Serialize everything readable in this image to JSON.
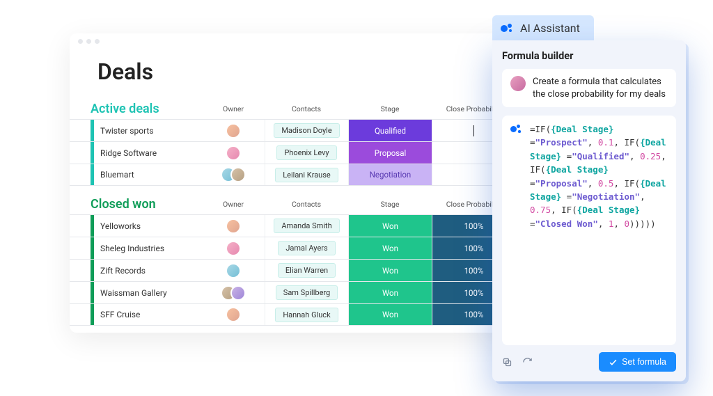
{
  "page": {
    "title": "Deals"
  },
  "columns": {
    "owner": "Owner",
    "contacts": "Contacts",
    "stage": "Stage",
    "prob": "Close Probability"
  },
  "sections": {
    "active": {
      "title": "Active deals",
      "rows": [
        {
          "name": "Twister sports",
          "owners": 1,
          "contact": "Madison Doyle",
          "stage": "Qualified",
          "stage_color": "#6c3bdc",
          "prob": ""
        },
        {
          "name": "Ridge Software",
          "owners": 1,
          "contact": "Phoenix Levy",
          "stage": "Proposal",
          "stage_color": "#9b4bdc",
          "prob": ""
        },
        {
          "name": "Bluemart",
          "owners": 2,
          "contact": "Leilani Krause",
          "stage": "Negotiation",
          "stage_color": "#c9b3f5",
          "prob": ""
        }
      ]
    },
    "closed": {
      "title": "Closed won",
      "rows": [
        {
          "name": "Yelloworks",
          "owners": 1,
          "contact": "Amanda Smith",
          "stage": "Won",
          "stage_color": "#1fc58c",
          "prob": "100%"
        },
        {
          "name": "Sheleg Industries",
          "owners": 1,
          "contact": "Jamal Ayers",
          "stage": "Won",
          "stage_color": "#1fc58c",
          "prob": "100%"
        },
        {
          "name": "Zift Records",
          "owners": 1,
          "contact": "Elian Warren",
          "stage": "Won",
          "stage_color": "#1fc58c",
          "prob": "100%"
        },
        {
          "name": "Waissman Gallery",
          "owners": 2,
          "contact": "Sam Spillberg",
          "stage": "Won",
          "stage_color": "#1fc58c",
          "prob": "100%"
        },
        {
          "name": "SFF Cruise",
          "owners": 1,
          "contact": "Hannah Gluck",
          "stage": "Won",
          "stage_color": "#1fc58c",
          "prob": "100%"
        }
      ]
    }
  },
  "assistant": {
    "tab_label": "AI Assistant",
    "panel_title": "Formula builder",
    "user_message": "Create a formula that calculates the close probability for my deals",
    "formula_tokens": [
      {
        "t": "=IF("
      },
      {
        "t": "{Deal Stage}",
        "c": "col"
      },
      {
        "t": " ="
      },
      {
        "t": "\"Prospect\"",
        "c": "str"
      },
      {
        "t": ", "
      },
      {
        "t": "0.1",
        "c": "num"
      },
      {
        "t": ", IF("
      },
      {
        "t": "{Deal Stage}",
        "c": "col"
      },
      {
        "t": " ="
      },
      {
        "t": "\"Qualified\"",
        "c": "str"
      },
      {
        "t": ", "
      },
      {
        "t": "0.25",
        "c": "num"
      },
      {
        "t": ", IF("
      },
      {
        "t": "{Deal Stage}",
        "c": "col"
      },
      {
        "t": " ="
      },
      {
        "t": "\"Proposal\"",
        "c": "str"
      },
      {
        "t": ", "
      },
      {
        "t": "0.5",
        "c": "num"
      },
      {
        "t": ", IF("
      },
      {
        "t": "{Deal Stage}",
        "c": "col"
      },
      {
        "t": " ="
      },
      {
        "t": "\"Negotiation\"",
        "c": "str"
      },
      {
        "t": ", "
      },
      {
        "t": "0.75",
        "c": "num"
      },
      {
        "t": ", IF("
      },
      {
        "t": "{Deal Stage}",
        "c": "col"
      },
      {
        "t": " ="
      },
      {
        "t": "\"Closed Won\"",
        "c": "str"
      },
      {
        "t": ", "
      },
      {
        "t": "1",
        "c": "num"
      },
      {
        "t": ", "
      },
      {
        "t": "0",
        "c": "num"
      },
      {
        "t": ")))))"
      }
    ],
    "set_button": "Set formula"
  }
}
